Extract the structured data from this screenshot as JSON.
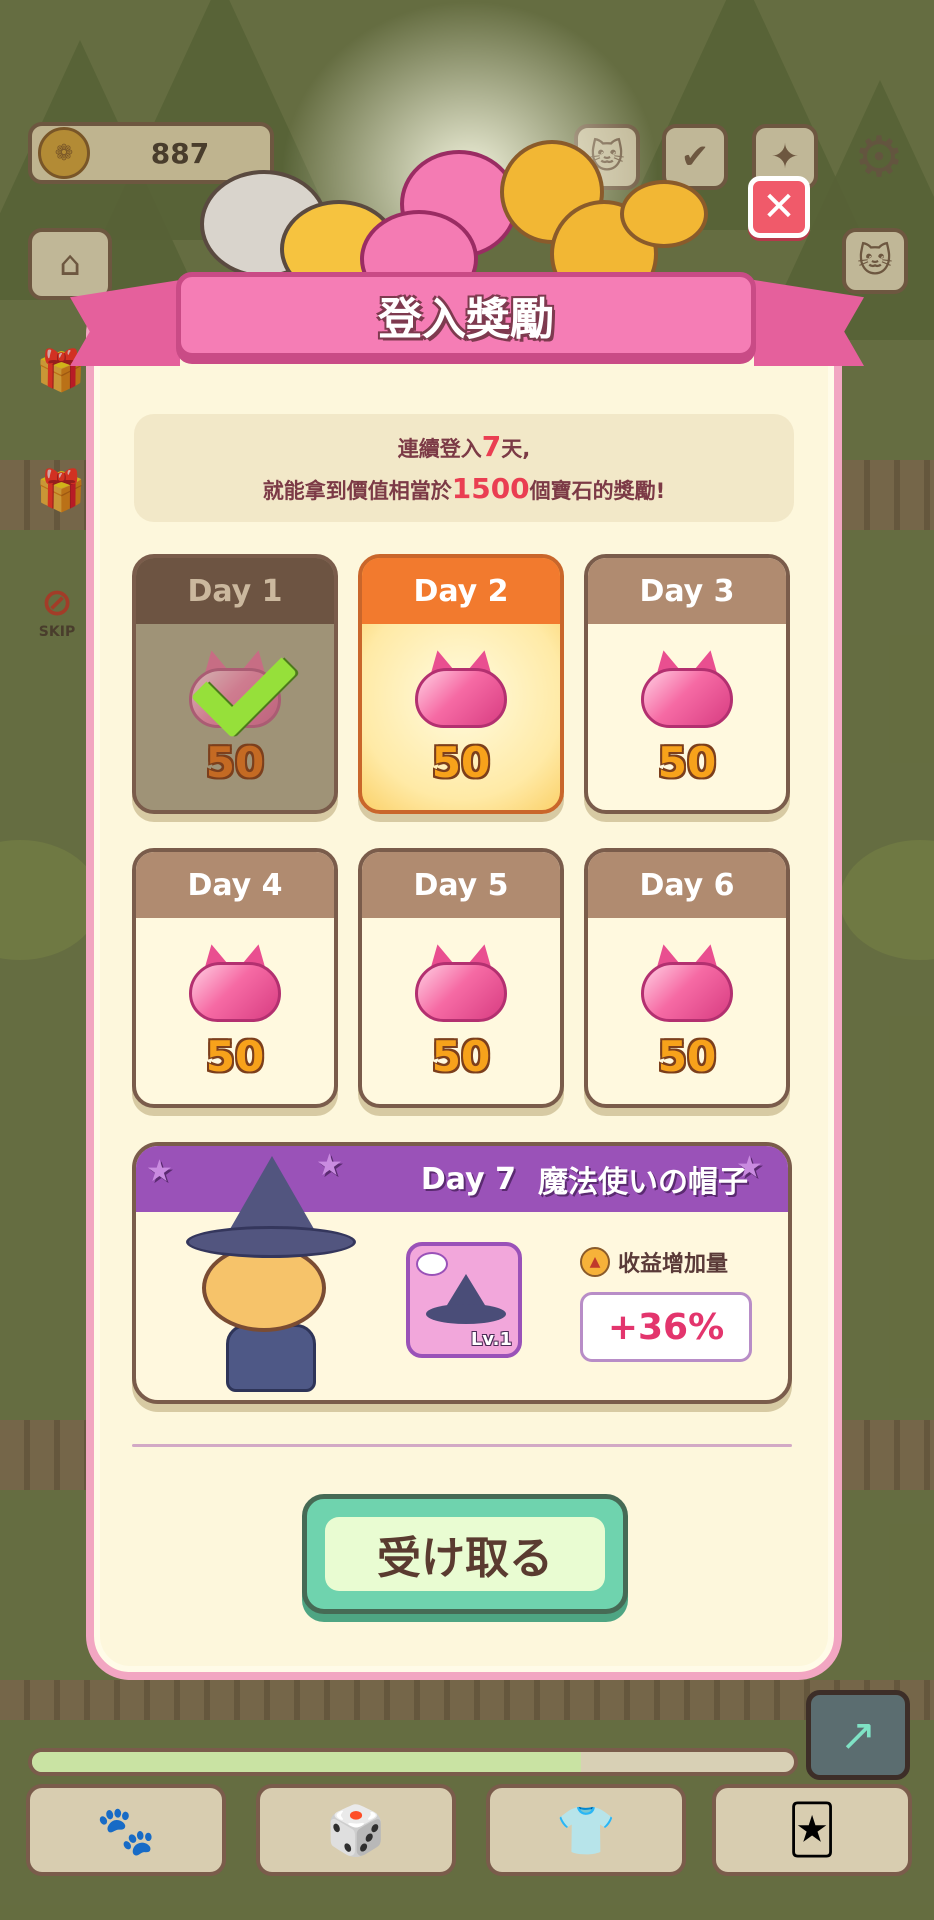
{
  "hud": {
    "coins": "887",
    "skip_label": "SKIP"
  },
  "popup": {
    "title": "登入獎勵",
    "info_line1_prefix": "連續登入",
    "info_line1_num": "7",
    "info_line1_suffix": "天,",
    "info_line2_prefix": "就能拿到價值相當於",
    "info_line2_num": "1500",
    "info_line2_suffix": "個寶石的獎勵!",
    "days": [
      {
        "label": "Day 1",
        "amount": "50",
        "state": "claimed"
      },
      {
        "label": "Day 2",
        "amount": "50",
        "state": "today"
      },
      {
        "label": "Day 3",
        "amount": "50",
        "state": "locked"
      },
      {
        "label": "Day 4",
        "amount": "50",
        "state": "locked"
      },
      {
        "label": "Day 5",
        "amount": "50",
        "state": "locked"
      },
      {
        "label": "Day 6",
        "amount": "50",
        "state": "locked"
      }
    ],
    "day7": {
      "label": "Day 7",
      "item_name": "魔法使いの帽子",
      "level": "Lv.1",
      "bonus_label": "收益增加量",
      "bonus_value": "+36%"
    },
    "claim_label": "受け取る"
  },
  "progress": {
    "fill": 0.72
  },
  "colors": {
    "panel_border": "#f2a6c2",
    "title_banner": "#f57db5",
    "today_head": "#f27a2e",
    "day7_head": "#9a52b8",
    "claim_button": "#6fd3ae"
  }
}
